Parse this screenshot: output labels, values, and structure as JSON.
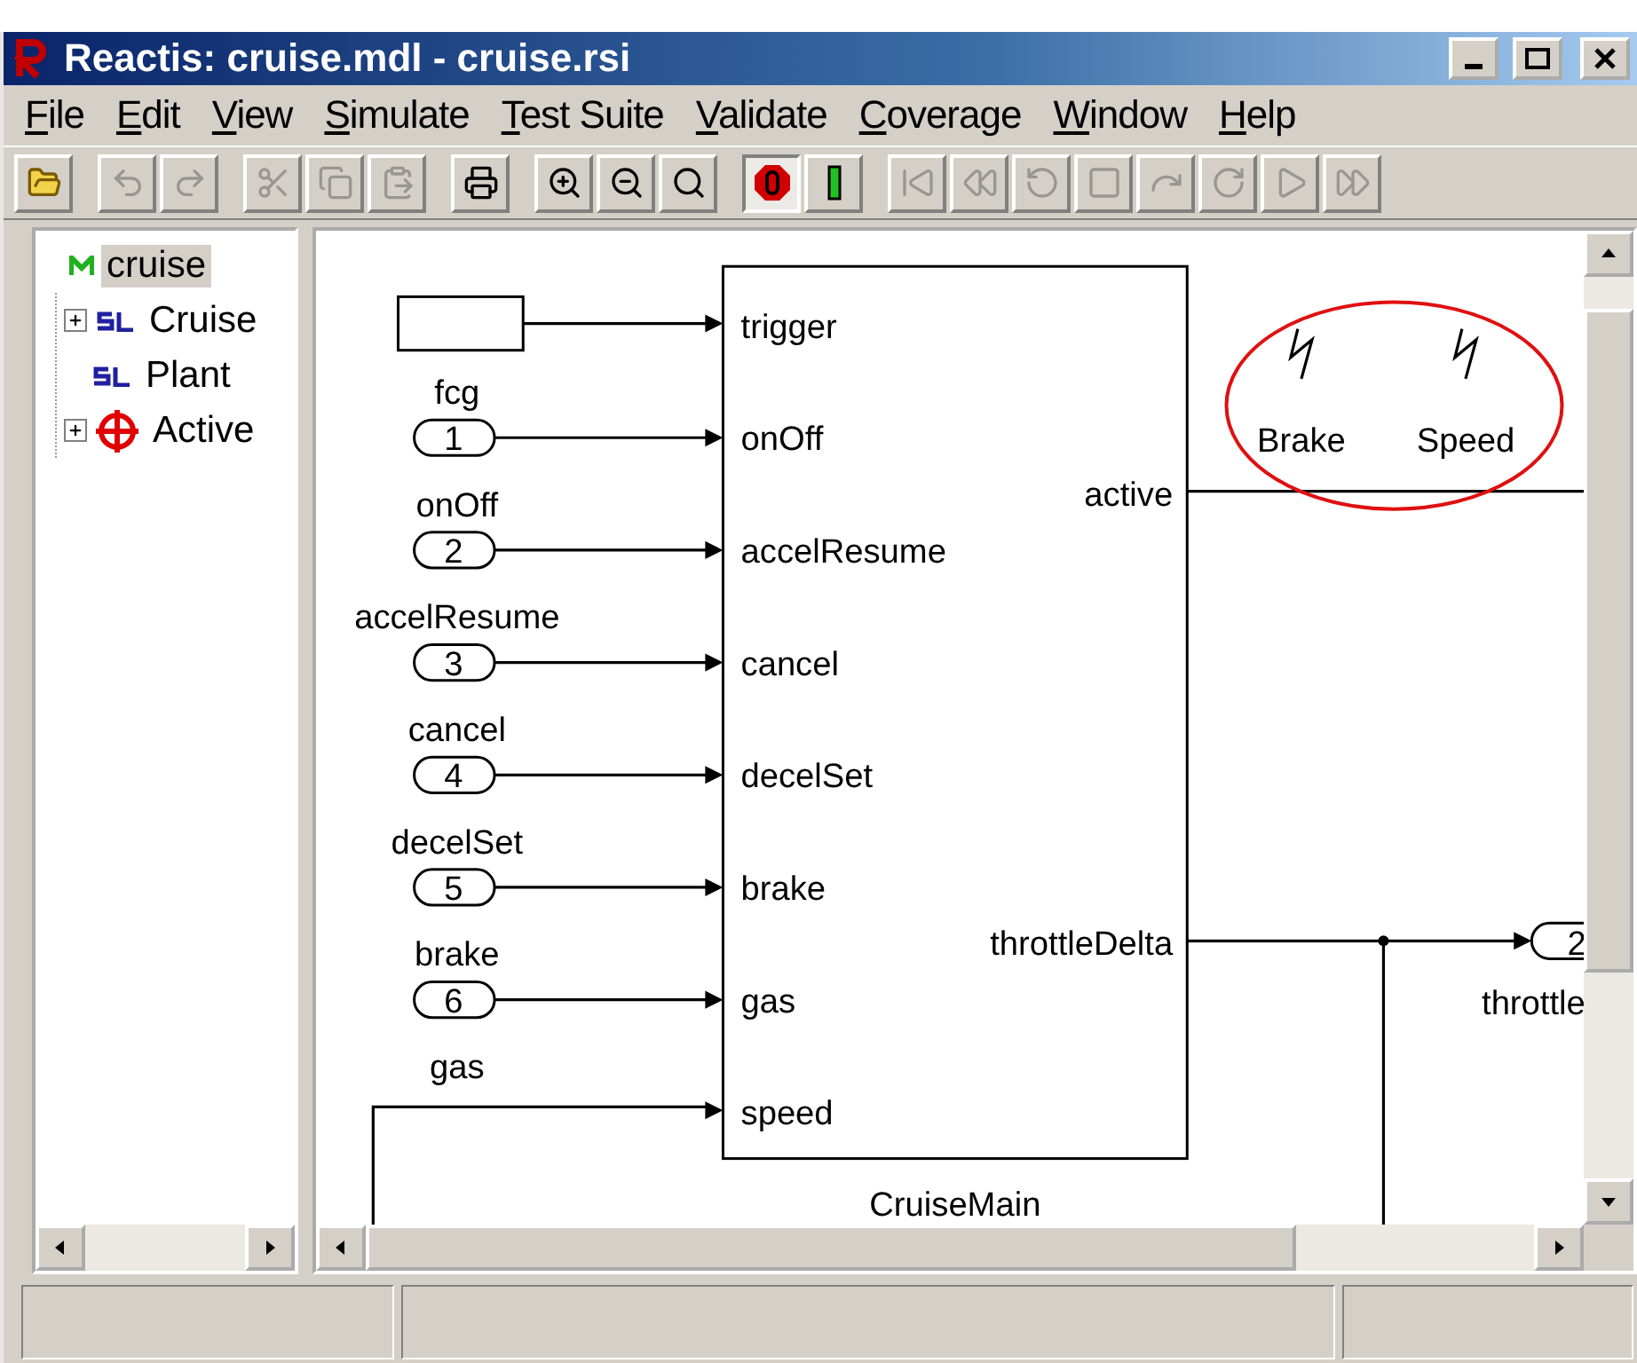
{
  "window": {
    "title": "Reactis: cruise.mdl - cruise.rsi"
  },
  "menu": [
    "File",
    "Edit",
    "View",
    "Simulate",
    "Test Suite",
    "Validate",
    "Coverage",
    "Window",
    "Help"
  ],
  "toolbar": [
    {
      "kind": "open",
      "disabled": false
    },
    {
      "kind": "undo",
      "disabled": true
    },
    {
      "kind": "redo",
      "disabled": true
    },
    {
      "kind": "cut",
      "disabled": true
    },
    {
      "kind": "copy",
      "disabled": true
    },
    {
      "kind": "paste",
      "disabled": true
    },
    {
      "kind": "print",
      "disabled": false
    },
    {
      "kind": "zoomin",
      "disabled": false
    },
    {
      "kind": "zoomout",
      "disabled": false
    },
    {
      "kind": "zoomfit",
      "disabled": false
    },
    {
      "kind": "off",
      "pressed": true
    },
    {
      "kind": "on",
      "pressed": false
    },
    {
      "kind": "first",
      "disabled": true
    },
    {
      "kind": "back",
      "disabled": true
    },
    {
      "kind": "stepback",
      "disabled": true
    },
    {
      "kind": "stop",
      "disabled": true
    },
    {
      "kind": "step",
      "disabled": true
    },
    {
      "kind": "stepover",
      "disabled": true
    },
    {
      "kind": "play",
      "disabled": true
    },
    {
      "kind": "forward",
      "disabled": true
    }
  ],
  "tree": [
    {
      "label": "cruise",
      "kind": "model",
      "selected": true,
      "children": [
        {
          "label": "Cruise",
          "kind": "sl",
          "selected": false,
          "expanded": false
        },
        {
          "label": "Plant",
          "kind": "sl",
          "selected": false
        },
        {
          "label": "Active",
          "kind": "target",
          "selected": false,
          "expanded": false
        }
      ]
    }
  ],
  "diagram": {
    "block": {
      "name": "CruiseMain",
      "inputs": [
        "trigger",
        "onOff",
        "accelResume",
        "cancel",
        "decelSet",
        "brake",
        "gas",
        "speed"
      ],
      "outputs": [
        "active",
        "throttleDelta"
      ]
    },
    "sources": [
      {
        "kind": "constant",
        "label": "fcg"
      },
      {
        "kind": "inport",
        "number": "1",
        "label": "onOff"
      },
      {
        "kind": "inport",
        "number": "2",
        "label": "accelResume"
      },
      {
        "kind": "inport",
        "number": "3",
        "label": "cancel"
      },
      {
        "kind": "inport",
        "number": "4",
        "label": "decelSet"
      },
      {
        "kind": "inport",
        "number": "5",
        "label": "brake"
      },
      {
        "kind": "inport",
        "number": "6",
        "label": "gas"
      }
    ],
    "outport": {
      "number": "2",
      "label": "throttle"
    },
    "highlighted": [
      "Brake",
      "Speed"
    ]
  }
}
